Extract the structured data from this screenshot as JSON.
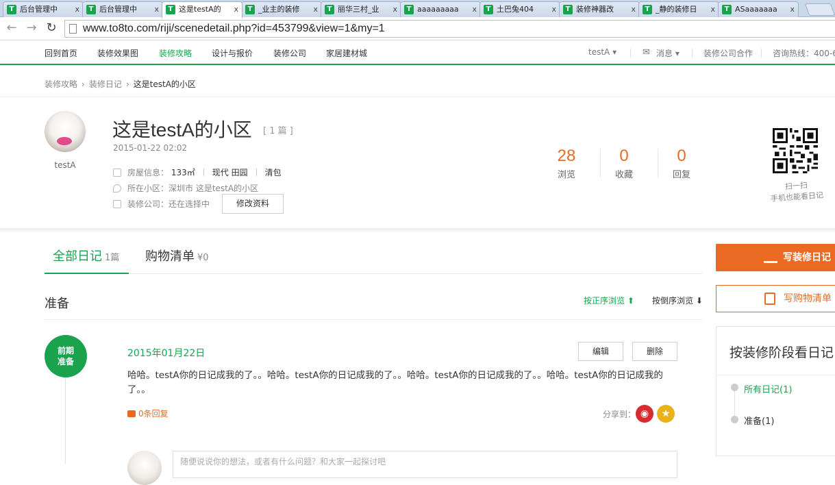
{
  "browser": {
    "tabs": [
      {
        "label": "后台管理中"
      },
      {
        "label": "后台管理中"
      },
      {
        "label": "这是testA的"
      },
      {
        "label": "_业主的装修"
      },
      {
        "label": "丽华三村_业"
      },
      {
        "label": "aaaaaaaaa"
      },
      {
        "label": "土巴兔404"
      },
      {
        "label": "装修神器改"
      },
      {
        "label": "_静的装修日"
      },
      {
        "label": "ASaaaaaaa"
      }
    ],
    "url": "www.to8to.com/riji/scenedetail.php?id=453799&view=1&my=1"
  },
  "nav": {
    "home": "回到首页",
    "effects": "装修效果图",
    "guide": "装修攻略",
    "design": "设计与报价",
    "company": "装修公司",
    "materials": "家居建材城",
    "user": "testA ▾",
    "messages": "消息 ▾",
    "cooperate": "装修公司合作",
    "hotline": "咨询热线：400-6"
  },
  "breadcrumb": {
    "level1": "装修攻略",
    "level2": "装修日记",
    "current": "这是testA的小区"
  },
  "profile": {
    "username": "testA",
    "title": "这是testA的小区",
    "count": "[ 1 篇 ]",
    "date": "2015-01-22 02:02",
    "house_label": "房屋信息：",
    "area": "133㎡",
    "style": "现代 田园",
    "contract": "清包",
    "community_label": "所在小区：",
    "community": "深圳市 这是testA的小区",
    "company_label": "装修公司：",
    "company": "还在选择中",
    "edit_button": "修改资料"
  },
  "stats": {
    "views": "28",
    "views_label": "浏览",
    "favorites": "0",
    "favorites_label": "收藏",
    "replies": "0",
    "replies_label": "回复"
  },
  "qr": {
    "line1": "扫一扫",
    "line2": "手机也能看日记"
  },
  "tabs": {
    "all_label": "全部日记",
    "all_count": "1篇",
    "shop_label": "购物清单",
    "shop_count": "¥0"
  },
  "stage": {
    "name": "准备",
    "sort_asc": "按正序浏览 ⬆",
    "sort_desc": "按倒序浏览 ⬇"
  },
  "entry": {
    "phase_line1": "前期",
    "phase_line2": "准备",
    "date": "2015年01月22日",
    "edit": "编辑",
    "delete": "删除",
    "text": "哈哈。testA你的日记成我的了。。哈哈。testA你的日记成我的了。。哈哈。testA你的日记成我的了。。哈哈。testA你的日记成我的了。。",
    "replies": "0条回复",
    "share_label": "分享到：",
    "comment_placeholder": "随便说说你的想法，或者有什么问题？和大家一起探讨吧"
  },
  "sidebar": {
    "write_diary": "写装修日记",
    "write_shopping": "写购物清单",
    "stage_heading": "按装修阶段看日记",
    "all_diaries": "所有日记(1)",
    "prep": "准备(1)"
  },
  "colors": {
    "brand_green": "#1aa24d",
    "accent_orange": "#ea6a24"
  }
}
